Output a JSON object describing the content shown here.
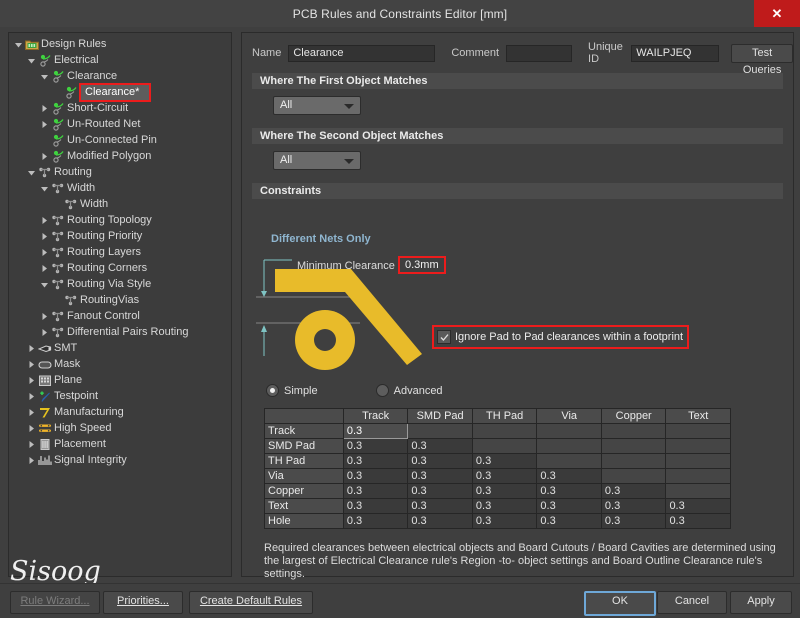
{
  "window": {
    "title": "PCB Rules and Constraints Editor [mm]",
    "close_label": "✕",
    "close_icon": "close-icon"
  },
  "tree": {
    "items": [
      {
        "label": "Design Rules",
        "depth": 0,
        "icon": "design-rules-folder-icon",
        "expander": "expanded",
        "selected": false
      },
      {
        "label": "Electrical",
        "depth": 1,
        "icon": "electrical-icon",
        "expander": "expanded",
        "selected": false
      },
      {
        "label": "Clearance",
        "depth": 2,
        "icon": "electrical-icon",
        "expander": "expanded",
        "selected": false
      },
      {
        "label": "Clearance*",
        "depth": 3,
        "icon": "electrical-icon",
        "expander": "none",
        "selected": true
      },
      {
        "label": "Short-Circuit",
        "depth": 2,
        "icon": "electrical-icon",
        "expander": "collapsed",
        "selected": false
      },
      {
        "label": "Un-Routed Net",
        "depth": 2,
        "icon": "electrical-icon",
        "expander": "collapsed",
        "selected": false
      },
      {
        "label": "Un-Connected Pin",
        "depth": 2,
        "icon": "electrical-icon",
        "expander": "none",
        "selected": false
      },
      {
        "label": "Modified Polygon",
        "depth": 2,
        "icon": "electrical-icon",
        "expander": "collapsed",
        "selected": false
      },
      {
        "label": "Routing",
        "depth": 1,
        "icon": "routing-icon",
        "expander": "expanded",
        "selected": false
      },
      {
        "label": "Width",
        "depth": 2,
        "icon": "routing-icon",
        "expander": "expanded",
        "selected": false
      },
      {
        "label": "Width",
        "depth": 3,
        "icon": "routing-icon",
        "expander": "none",
        "selected": false
      },
      {
        "label": "Routing Topology",
        "depth": 2,
        "icon": "routing-icon",
        "expander": "collapsed",
        "selected": false
      },
      {
        "label": "Routing Priority",
        "depth": 2,
        "icon": "routing-icon",
        "expander": "collapsed",
        "selected": false
      },
      {
        "label": "Routing Layers",
        "depth": 2,
        "icon": "routing-icon",
        "expander": "collapsed",
        "selected": false
      },
      {
        "label": "Routing Corners",
        "depth": 2,
        "icon": "routing-icon",
        "expander": "collapsed",
        "selected": false
      },
      {
        "label": "Routing Via Style",
        "depth": 2,
        "icon": "routing-icon",
        "expander": "expanded",
        "selected": false
      },
      {
        "label": "RoutingVias",
        "depth": 3,
        "icon": "routing-icon",
        "expander": "none",
        "selected": false
      },
      {
        "label": "Fanout Control",
        "depth": 2,
        "icon": "routing-icon",
        "expander": "collapsed",
        "selected": false
      },
      {
        "label": "Differential Pairs Routing",
        "depth": 2,
        "icon": "routing-icon",
        "expander": "collapsed",
        "selected": false
      },
      {
        "label": "SMT",
        "depth": 1,
        "icon": "smt-icon",
        "expander": "collapsed",
        "selected": false
      },
      {
        "label": "Mask",
        "depth": 1,
        "icon": "mask-icon",
        "expander": "collapsed",
        "selected": false
      },
      {
        "label": "Plane",
        "depth": 1,
        "icon": "plane-icon",
        "expander": "collapsed",
        "selected": false
      },
      {
        "label": "Testpoint",
        "depth": 1,
        "icon": "testpoint-icon",
        "expander": "collapsed",
        "selected": false
      },
      {
        "label": "Manufacturing",
        "depth": 1,
        "icon": "manufacturing-icon",
        "expander": "collapsed",
        "selected": false
      },
      {
        "label": "High Speed",
        "depth": 1,
        "icon": "high-speed-icon",
        "expander": "collapsed",
        "selected": false
      },
      {
        "label": "Placement",
        "depth": 1,
        "icon": "placement-icon",
        "expander": "collapsed",
        "selected": false
      },
      {
        "label": "Signal Integrity",
        "depth": 1,
        "icon": "signal-integrity-icon",
        "expander": "collapsed",
        "selected": false
      }
    ]
  },
  "form": {
    "name_label": "Name",
    "name_value": "Clearance",
    "comment_label": "Comment",
    "comment_value": "",
    "unique_id_label": "Unique ID",
    "unique_id_value": "WAILPJEQ",
    "test_queries_label": "Test Queries"
  },
  "sections": {
    "first_object": {
      "header": "Where The First Object Matches",
      "combo_value": "All"
    },
    "second_object": {
      "header": "Where The Second Object Matches",
      "combo_value": "All"
    },
    "constraints": {
      "header": "Constraints"
    }
  },
  "constraints": {
    "different_nets_only": "Different Nets Only",
    "minimum_clearance_label": "Minimum Clearance",
    "minimum_clearance_value": "0.3mm",
    "ignore_pad_label": "Ignore Pad to Pad clearances within a footprint",
    "ignore_pad_checked": true,
    "mode_simple": "Simple",
    "mode_advanced": "Advanced",
    "mode_selected": "Simple",
    "note": "Required clearances between electrical objects and Board Cutouts / Board Cavities are determined using the largest of Electrical Clearance rule's Region -to- object settings and Board Outline Clearance rule's settings."
  },
  "matrix": {
    "columns": [
      "",
      "Track",
      "SMD Pad",
      "TH Pad",
      "Via",
      "Copper",
      "Text"
    ],
    "rows": [
      {
        "label": "Track",
        "values": [
          "0.3",
          "",
          "",
          "",
          "",
          ""
        ],
        "selected_index": 0
      },
      {
        "label": "SMD Pad",
        "values": [
          "0.3",
          "0.3",
          "",
          "",
          "",
          ""
        ],
        "selected_index": -1
      },
      {
        "label": "TH Pad",
        "values": [
          "0.3",
          "0.3",
          "0.3",
          "",
          "",
          ""
        ],
        "selected_index": -1
      },
      {
        "label": "Via",
        "values": [
          "0.3",
          "0.3",
          "0.3",
          "0.3",
          "",
          ""
        ],
        "selected_index": -1
      },
      {
        "label": "Copper",
        "values": [
          "0.3",
          "0.3",
          "0.3",
          "0.3",
          "0.3",
          ""
        ],
        "selected_index": -1
      },
      {
        "label": "Text",
        "values": [
          "0.3",
          "0.3",
          "0.3",
          "0.3",
          "0.3",
          "0.3"
        ],
        "selected_index": -1
      },
      {
        "label": "Hole",
        "values": [
          "0.3",
          "0.3",
          "0.3",
          "0.3",
          "0.3",
          "0.3"
        ],
        "selected_index": -1
      }
    ]
  },
  "watermark": {
    "text": "Sisoog"
  },
  "footer": {
    "rule_wizard": "Rule Wizard...",
    "priorities": "Priorities...",
    "create_default_rules": "Create Default Rules",
    "ok": "OK",
    "cancel": "Cancel",
    "apply": "Apply"
  },
  "colors": {
    "accent_red": "#ec1c1c",
    "track_yellow": "#e8bb2a",
    "section_header": "#4b4b4b",
    "link_blue": "#8fb6d0",
    "close_red": "#bf1b1b"
  }
}
